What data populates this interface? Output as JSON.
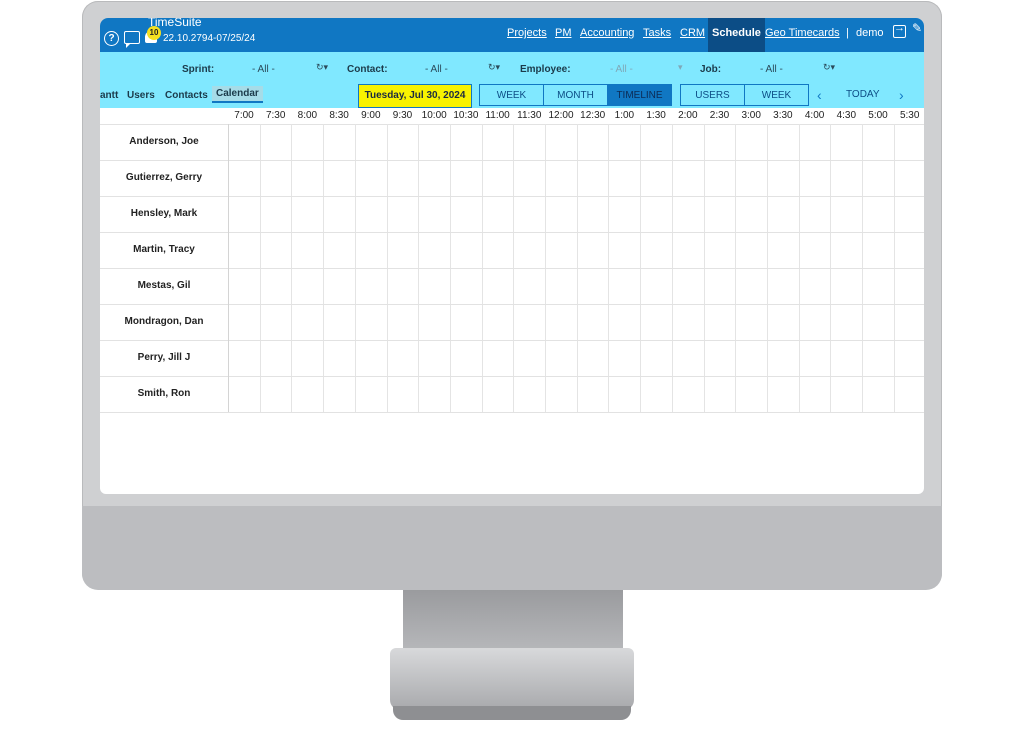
{
  "app": {
    "title": "TimeSuite",
    "version": "22.10.2794-07/25/24",
    "notification_count": "10"
  },
  "nav": {
    "items": [
      {
        "label": "Projects"
      },
      {
        "label": "PM"
      },
      {
        "label": "Accounting"
      },
      {
        "label": "Tasks"
      },
      {
        "label": "CRM"
      },
      {
        "label": "Schedule",
        "active": true
      },
      {
        "label": "Geo Timecards"
      }
    ],
    "separator": "|",
    "user": "demo"
  },
  "filters": {
    "sprint": {
      "label": "Sprint:",
      "value": "- All -"
    },
    "contact": {
      "label": "Contact:",
      "value": "- All -"
    },
    "employee": {
      "label": "Employee:",
      "value": "- All -"
    },
    "job": {
      "label": "Job:",
      "value": "- All -"
    }
  },
  "tabs": [
    {
      "label": "antt"
    },
    {
      "label": "Users"
    },
    {
      "label": "Contacts"
    },
    {
      "label": "Calendar",
      "active": true
    }
  ],
  "date_label": "Tuesday, Jul 30, 2024",
  "views": [
    {
      "label": "WEEK"
    },
    {
      "label": "MONTH"
    },
    {
      "label": "TIMELINE",
      "active": true
    },
    {
      "label": "USERS"
    },
    {
      "label": "WEEK USERS"
    }
  ],
  "today_label": "TODAY",
  "times": [
    "7:00",
    "7:30",
    "8:00",
    "8:30",
    "9:00",
    "9:30",
    "10:00",
    "10:30",
    "11:00",
    "11:30",
    "12:00",
    "12:30",
    "1:00",
    "1:30",
    "2:00",
    "2:30",
    "3:00",
    "3:30",
    "4:00",
    "4:30",
    "5:00",
    "5:30"
  ],
  "employees": [
    "Anderson, Joe",
    "Gutierrez, Gerry",
    "Hensley, Mark",
    "Martin, Tracy",
    "Mestas, Gil",
    "Mondragon, Dan",
    "Perry, Jill J",
    "Smith, Ron"
  ],
  "colors": {
    "topbar": "#1077c3",
    "active_nav": "#0c4d86",
    "filterbar": "#80e8ff",
    "date_highlight": "#f8f200"
  }
}
